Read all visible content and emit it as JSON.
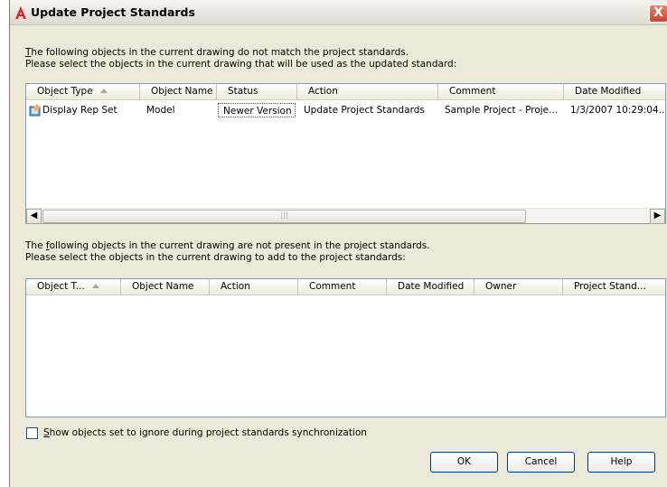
{
  "window": {
    "title": "Update Project Standards",
    "close_label": "X"
  },
  "top_section": {
    "intro_line1_u": "T",
    "intro_line1_rest": "he following objects in the current drawing do not match the project standards.",
    "intro_line2": "Please select the objects in the current drawing that will be used as the updated standard:",
    "columns": [
      "Object Type",
      "Object Name",
      "Status",
      "Action",
      "Comment",
      "Date Modified"
    ],
    "rows": [
      {
        "object_type": "Display Rep Set",
        "object_name": "Model",
        "status": "Newer Version",
        "action": "Update Project Standards",
        "comment": "Sample Project - Proje...",
        "date_modified": "1/3/2007 10:29:04..."
      }
    ],
    "scroll_thumb_grip": "|||"
  },
  "bottom_section": {
    "intro_line1_pre": "The ",
    "intro_line1_u": "f",
    "intro_line1_rest": "ollowing objects in the current drawing are not present in the project standards.",
    "intro_line2": "Please select the objects in the current drawing to add to the project standards:",
    "columns": [
      "Object T...",
      "Object Name",
      "Action",
      "Comment",
      "Date Modified",
      "Owner",
      "Project Stand..."
    ]
  },
  "options": {
    "show_ignored_u": "S",
    "show_ignored_rest": "how objects set to ignore during project standards synchronization",
    "show_ignored_checked": false
  },
  "buttons": {
    "ok": "OK",
    "cancel": "Cancel",
    "help": "Help"
  },
  "icons": {
    "app": "autocad-a-icon",
    "row": "display-rep-set-icon",
    "sort": "sort-ascending-icon",
    "scroll_left": "◀",
    "scroll_right": "▶"
  },
  "colors": {
    "close_button": "#c8462d",
    "window_bg": "#ece9d8",
    "list_border": "#7f9db9"
  }
}
